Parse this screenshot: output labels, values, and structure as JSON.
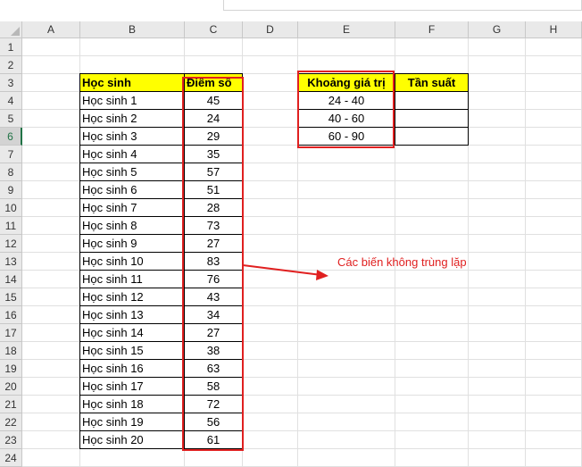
{
  "columns": [
    "A",
    "B",
    "C",
    "D",
    "E",
    "F",
    "G",
    "H"
  ],
  "rows": [
    "1",
    "2",
    "3",
    "4",
    "5",
    "6",
    "7",
    "8",
    "9",
    "10",
    "11",
    "12",
    "13",
    "14",
    "15",
    "16",
    "17",
    "18",
    "19",
    "20",
    "21",
    "22",
    "23",
    "24"
  ],
  "active_row": "6",
  "table_main": {
    "header_student": "Học sinh",
    "header_score": "Điểm số",
    "students": [
      "Học sinh 1",
      "Học sinh 2",
      "Học sinh 3",
      "Học sinh 4",
      "Học sinh 5",
      "Học sinh 6",
      "Học sinh 7",
      "Học sinh 8",
      "Học sinh 9",
      "Học sinh 10",
      "Học sinh 11",
      "Học sinh 12",
      "Học sinh 13",
      "Học sinh 14",
      "Học sinh 15",
      "Học sinh 16",
      "Học sinh 17",
      "Học sinh 18",
      "Học sinh 19",
      "Học sinh 20"
    ],
    "scores": [
      "45",
      "24",
      "29",
      "35",
      "57",
      "51",
      "28",
      "73",
      "27",
      "83",
      "76",
      "43",
      "34",
      "27",
      "38",
      "63",
      "58",
      "72",
      "56",
      "61"
    ]
  },
  "table_freq": {
    "header_range": "Khoảng giá trị",
    "header_freq": "Tần suất",
    "ranges": [
      "24 - 40",
      "40 - 60",
      "60 - 90"
    ]
  },
  "annotation": "Các biến không trùng lặp",
  "colors": {
    "highlight": "#ffff00",
    "annotation": "#e02020",
    "active_accent": "#217346"
  }
}
